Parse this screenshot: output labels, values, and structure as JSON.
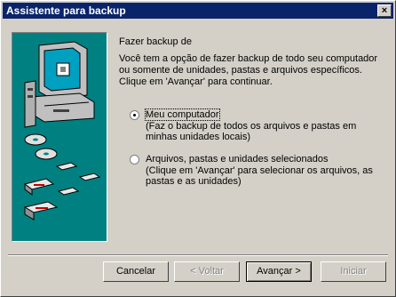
{
  "window": {
    "title": "Assistente para backup",
    "close_label": "×"
  },
  "main": {
    "heading": "Fazer backup de",
    "description": "Você tem a opção de fazer backup de todo seu computador ou somente de unidades, pastas e arquivos específicos. Clique em 'Avançar' para continuar.",
    "options": [
      {
        "title": "Meu computador",
        "description": "(Faz o backup de todos os arquivos e pastas em minhas unidades locais)",
        "selected": true
      },
      {
        "title": "Arquivos, pastas e unidades selecionados",
        "description": "(Clique em 'Avançar' para selecionar os arquivos, as pastas e as unidades)",
        "selected": false
      }
    ]
  },
  "buttons": {
    "cancel": "Cancelar",
    "back": "< Voltar",
    "next": "Avançar >",
    "start": "Iniciar"
  },
  "colors": {
    "titlebar": "#0a246a",
    "illustration_bg": "#008080",
    "face": "#d4d0c8"
  }
}
